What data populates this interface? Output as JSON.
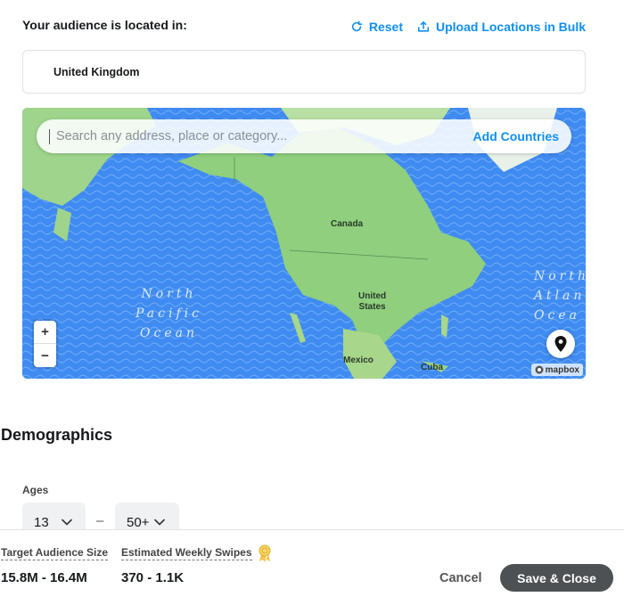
{
  "location": {
    "title": "Your audience is located in:",
    "reset_label": "Reset",
    "upload_label": "Upload Locations in Bulk",
    "selected_country": "United Kingdom"
  },
  "map": {
    "search_placeholder": "Search any address, place or category...",
    "add_countries_label": "Add Countries",
    "zoom_in": "+",
    "zoom_out": "−",
    "attribution": "mapbox",
    "oceans": {
      "north_pacific": [
        "North",
        "Pacific",
        "Ocean"
      ],
      "north_atlantic": [
        "North",
        "Atlan",
        "Ocea"
      ]
    },
    "places": {
      "canada": "Canada",
      "united_states_1": "United",
      "united_states_2": "States",
      "mexico": "Mexico",
      "cuba": "Cuba"
    }
  },
  "demographics": {
    "title": "Demographics",
    "ages_label": "Ages",
    "age_min": "13",
    "age_max": "50+",
    "age_separator": "–"
  },
  "footer": {
    "audience_size_label": "Target Audience Size",
    "audience_size_value": "15.8M - 16.4M",
    "weekly_swipes_label": "Estimated Weekly Swipes",
    "weekly_swipes_value": "370 - 1.1K",
    "cancel_label": "Cancel",
    "save_label": "Save & Close"
  },
  "colors": {
    "accent": "#0f8ff2",
    "ocean": "#3f8bf1",
    "land": "#8fcf7e",
    "save_button": "#4e5154"
  },
  "icons": {
    "reset": "refresh-icon",
    "upload": "upload-icon",
    "pin": "map-pin-icon",
    "award": "award-ribbon-icon",
    "chevron": "chevron-down-icon"
  }
}
